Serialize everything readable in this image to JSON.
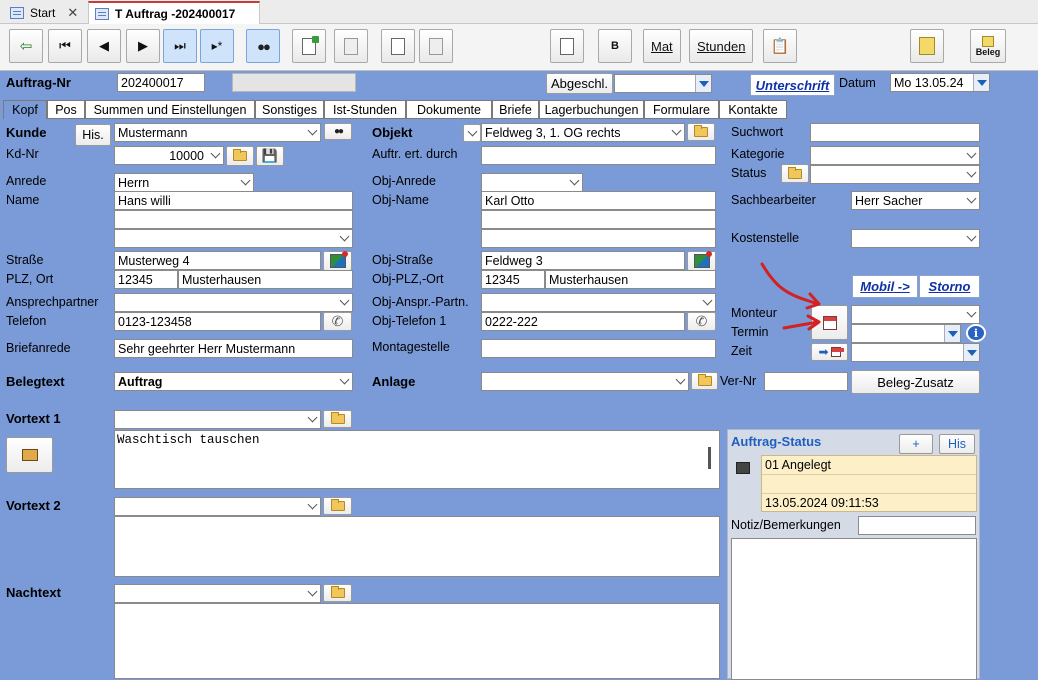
{
  "doc_tabs": [
    {
      "label": "Start",
      "active": false
    },
    {
      "label": "T Auftrag -202400017",
      "active": true
    }
  ],
  "toolbar": {
    "mat": "Mat",
    "stunden": "Stunden",
    "beleg": "Beleg"
  },
  "header": {
    "auftrag_nr_label": "Auftrag-Nr",
    "auftrag_nr": "202400017",
    "auftrag_extra": "",
    "status_button": "Abgeschl.",
    "status_value": "",
    "unterschrift": "Unterschrift",
    "datum_label": "Datum",
    "datum": "Mo 13.05.24"
  },
  "sheet_tabs": [
    "Kopf",
    "Pos",
    "Summen und Einstellungen",
    "Sonstiges",
    "Ist-Stunden",
    "Dokumente",
    "Briefe",
    "Lagerbuchungen",
    "Formulare",
    "Kontakte"
  ],
  "kunde": {
    "kunde_label": "Kunde",
    "his_button": "His.",
    "kunde": "Mustermann",
    "kdnr_label": "Kd-Nr",
    "kdnr": "10000",
    "anrede_label": "Anrede",
    "anrede": "Herrn",
    "name_label": "Name",
    "name": "Hans willi",
    "name2": "",
    "name3": "",
    "strasse_label": "Straße",
    "strasse": "Musterweg 4",
    "plz_ort_label": "PLZ, Ort",
    "plz": "12345",
    "ort": "Musterhausen",
    "ansprechpartner_label": "Ansprechpartner",
    "ansprechpartner": "",
    "telefon_label": "Telefon",
    "telefon": "0123-123458",
    "briefanrede_label": "Briefanrede",
    "briefanrede": "Sehr geehrter Herr Mustermann"
  },
  "objekt": {
    "objekt_label": "Objekt",
    "objekt": "Feldweg 3, 1. OG rechts",
    "auftr_label": "Auftr. ert. durch",
    "auftr": "",
    "anrede_label": "Obj-Anrede",
    "anrede": "",
    "name_label": "Obj-Name",
    "name": "Karl Otto",
    "name2": "",
    "name3": "",
    "strasse_label": "Obj-Straße",
    "strasse": "Feldweg 3",
    "plz_ort_label": "Obj-PLZ,-Ort",
    "plz": "12345",
    "ort": "Musterhausen",
    "anspr_label": "Obj-Anspr.-Partn.",
    "anspr": "",
    "telefon_label": "Obj-Telefon 1",
    "telefon": "0222-222",
    "montagestelle_label": "Montagestelle",
    "montagestelle": ""
  },
  "right": {
    "suchwort_label": "Suchwort",
    "suchwort": "",
    "kategorie_label": "Kategorie",
    "kategorie": "",
    "status_label": "Status",
    "status": "",
    "sachbearbeiter_label": "Sachbearbeiter",
    "sachbearbeiter": "Herr Sacher",
    "kostenstelle_label": "Kostenstelle",
    "kostenstelle": "",
    "mobil_button": "Mobil ->",
    "storno_button": "Storno",
    "monteur_label": "Monteur",
    "monteur": "",
    "termin_label": "Termin",
    "termin": "",
    "zeit_label": "Zeit",
    "zeit": ""
  },
  "beleg": {
    "belegtext_label": "Belegtext",
    "belegtext": "Auftrag",
    "anlage_label": "Anlage",
    "anlage": "",
    "vernr_label": "Ver-Nr",
    "vernr": "",
    "zusatz_button": "Beleg-Zusatz"
  },
  "texts": {
    "vortext1_label": "Vortext 1",
    "vortext1_select": "",
    "vortext1_body": "Waschtisch tauschen",
    "vortext2_label": "Vortext 2",
    "vortext2_select": "",
    "vortext2_body": "",
    "nachtext_label": "Nachtext",
    "nachtext_select": "",
    "nachtext_body": ""
  },
  "auftrag_status": {
    "title": "Auftrag-Status",
    "plus_button": "+",
    "his_button": "His",
    "status": "01 Angelegt",
    "line2": "",
    "timestamp": "13.05.2024 09:11:53",
    "notiz_label": "Notiz/Bemerkungen",
    "notiz": ""
  },
  "colors": {
    "form_bg": "#7a9bd8",
    "accent_red": "#d42020",
    "status_fill": "#fdf0c8"
  }
}
